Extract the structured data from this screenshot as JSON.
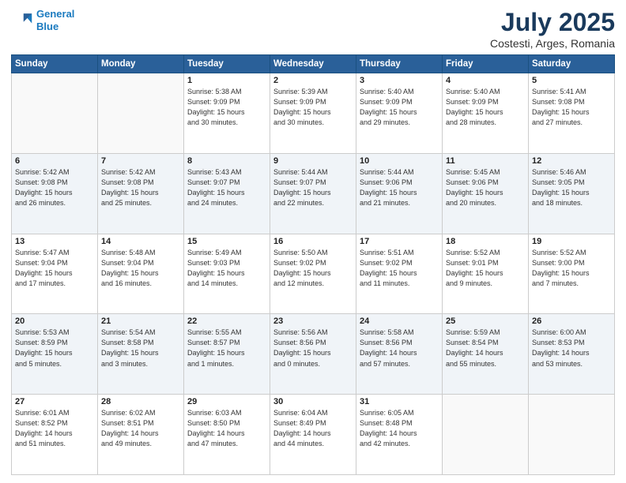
{
  "logo": {
    "line1": "General",
    "line2": "Blue"
  },
  "title": "July 2025",
  "subtitle": "Costesti, Arges, Romania",
  "weekdays": [
    "Sunday",
    "Monday",
    "Tuesday",
    "Wednesday",
    "Thursday",
    "Friday",
    "Saturday"
  ],
  "weeks": [
    [
      {
        "day": "",
        "info": ""
      },
      {
        "day": "",
        "info": ""
      },
      {
        "day": "1",
        "info": "Sunrise: 5:38 AM\nSunset: 9:09 PM\nDaylight: 15 hours\nand 30 minutes."
      },
      {
        "day": "2",
        "info": "Sunrise: 5:39 AM\nSunset: 9:09 PM\nDaylight: 15 hours\nand 30 minutes."
      },
      {
        "day": "3",
        "info": "Sunrise: 5:40 AM\nSunset: 9:09 PM\nDaylight: 15 hours\nand 29 minutes."
      },
      {
        "day": "4",
        "info": "Sunrise: 5:40 AM\nSunset: 9:09 PM\nDaylight: 15 hours\nand 28 minutes."
      },
      {
        "day": "5",
        "info": "Sunrise: 5:41 AM\nSunset: 9:08 PM\nDaylight: 15 hours\nand 27 minutes."
      }
    ],
    [
      {
        "day": "6",
        "info": "Sunrise: 5:42 AM\nSunset: 9:08 PM\nDaylight: 15 hours\nand 26 minutes."
      },
      {
        "day": "7",
        "info": "Sunrise: 5:42 AM\nSunset: 9:08 PM\nDaylight: 15 hours\nand 25 minutes."
      },
      {
        "day": "8",
        "info": "Sunrise: 5:43 AM\nSunset: 9:07 PM\nDaylight: 15 hours\nand 24 minutes."
      },
      {
        "day": "9",
        "info": "Sunrise: 5:44 AM\nSunset: 9:07 PM\nDaylight: 15 hours\nand 22 minutes."
      },
      {
        "day": "10",
        "info": "Sunrise: 5:44 AM\nSunset: 9:06 PM\nDaylight: 15 hours\nand 21 minutes."
      },
      {
        "day": "11",
        "info": "Sunrise: 5:45 AM\nSunset: 9:06 PM\nDaylight: 15 hours\nand 20 minutes."
      },
      {
        "day": "12",
        "info": "Sunrise: 5:46 AM\nSunset: 9:05 PM\nDaylight: 15 hours\nand 18 minutes."
      }
    ],
    [
      {
        "day": "13",
        "info": "Sunrise: 5:47 AM\nSunset: 9:04 PM\nDaylight: 15 hours\nand 17 minutes."
      },
      {
        "day": "14",
        "info": "Sunrise: 5:48 AM\nSunset: 9:04 PM\nDaylight: 15 hours\nand 16 minutes."
      },
      {
        "day": "15",
        "info": "Sunrise: 5:49 AM\nSunset: 9:03 PM\nDaylight: 15 hours\nand 14 minutes."
      },
      {
        "day": "16",
        "info": "Sunrise: 5:50 AM\nSunset: 9:02 PM\nDaylight: 15 hours\nand 12 minutes."
      },
      {
        "day": "17",
        "info": "Sunrise: 5:51 AM\nSunset: 9:02 PM\nDaylight: 15 hours\nand 11 minutes."
      },
      {
        "day": "18",
        "info": "Sunrise: 5:52 AM\nSunset: 9:01 PM\nDaylight: 15 hours\nand 9 minutes."
      },
      {
        "day": "19",
        "info": "Sunrise: 5:52 AM\nSunset: 9:00 PM\nDaylight: 15 hours\nand 7 minutes."
      }
    ],
    [
      {
        "day": "20",
        "info": "Sunrise: 5:53 AM\nSunset: 8:59 PM\nDaylight: 15 hours\nand 5 minutes."
      },
      {
        "day": "21",
        "info": "Sunrise: 5:54 AM\nSunset: 8:58 PM\nDaylight: 15 hours\nand 3 minutes."
      },
      {
        "day": "22",
        "info": "Sunrise: 5:55 AM\nSunset: 8:57 PM\nDaylight: 15 hours\nand 1 minutes."
      },
      {
        "day": "23",
        "info": "Sunrise: 5:56 AM\nSunset: 8:56 PM\nDaylight: 15 hours\nand 0 minutes."
      },
      {
        "day": "24",
        "info": "Sunrise: 5:58 AM\nSunset: 8:56 PM\nDaylight: 14 hours\nand 57 minutes."
      },
      {
        "day": "25",
        "info": "Sunrise: 5:59 AM\nSunset: 8:54 PM\nDaylight: 14 hours\nand 55 minutes."
      },
      {
        "day": "26",
        "info": "Sunrise: 6:00 AM\nSunset: 8:53 PM\nDaylight: 14 hours\nand 53 minutes."
      }
    ],
    [
      {
        "day": "27",
        "info": "Sunrise: 6:01 AM\nSunset: 8:52 PM\nDaylight: 14 hours\nand 51 minutes."
      },
      {
        "day": "28",
        "info": "Sunrise: 6:02 AM\nSunset: 8:51 PM\nDaylight: 14 hours\nand 49 minutes."
      },
      {
        "day": "29",
        "info": "Sunrise: 6:03 AM\nSunset: 8:50 PM\nDaylight: 14 hours\nand 47 minutes."
      },
      {
        "day": "30",
        "info": "Sunrise: 6:04 AM\nSunset: 8:49 PM\nDaylight: 14 hours\nand 44 minutes."
      },
      {
        "day": "31",
        "info": "Sunrise: 6:05 AM\nSunset: 8:48 PM\nDaylight: 14 hours\nand 42 minutes."
      },
      {
        "day": "",
        "info": ""
      },
      {
        "day": "",
        "info": ""
      }
    ]
  ]
}
